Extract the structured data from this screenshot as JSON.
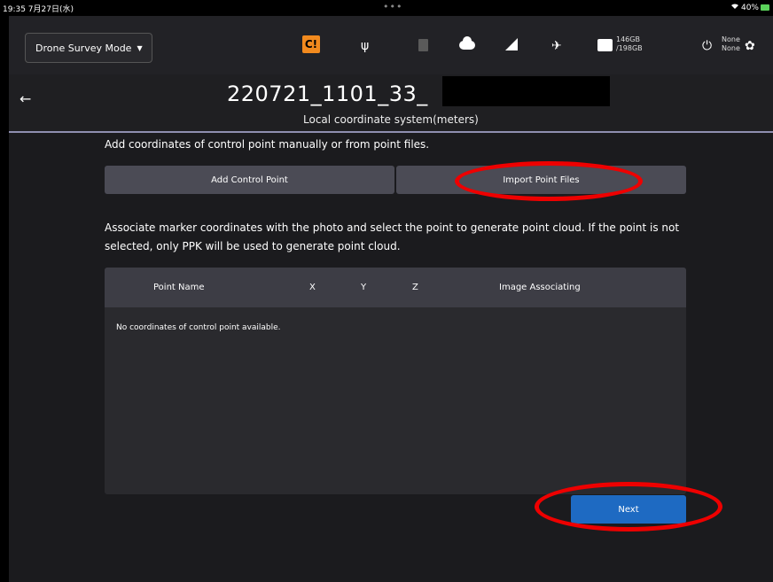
{
  "status_bar": {
    "time_date": "19:35  7月27日(水)",
    "dots": "•••",
    "wifi_icon": "wifi-icon",
    "battery_text": "40%"
  },
  "toolbar": {
    "mode_label": "Drone Survey Mode",
    "orange_icon_glyph": "C!",
    "usb_glyph": "ψ",
    "satellite_glyph": "✈",
    "storage_line1": "146GB",
    "storage_line2": "/198GB",
    "power_glyph": "⏻",
    "power_line1": "None",
    "power_line2": "None",
    "settings_glyph": "✿"
  },
  "header": {
    "back_glyph": "←",
    "project_name": "220721_1101_33_",
    "coordinate_system": "Local coordinate system(meters)"
  },
  "content": {
    "intro": "Add coordinates of control point manually or from point files.",
    "add_control_point": "Add Control Point",
    "import_point_files": "Import Point Files",
    "association_text": "Associate marker coordinates with the photo and select the point to generate point cloud. If the point is not selected, only PPK will be used to generate point cloud.",
    "table": {
      "columns": [
        "Point Name",
        "X",
        "Y",
        "Z",
        "Image Associating"
      ],
      "empty_message": "No coordinates of control point available."
    },
    "next_label": "Next"
  },
  "colors": {
    "accent_blue": "#1e6ac2",
    "warning_orange": "#f28a1e",
    "annotation_red": "#ee0000"
  }
}
